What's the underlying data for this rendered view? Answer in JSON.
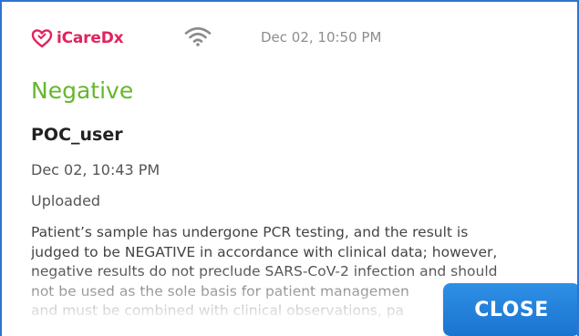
{
  "app": {
    "logo_text": "iCareDx",
    "logo_icon": "heart-icon",
    "brand_color": "#e0245e"
  },
  "status_bar": {
    "wifi_icon": "wifi-icon",
    "time": "Dec 02, 10:50 PM"
  },
  "result": {
    "title": "Negative",
    "title_color": "#64b82c",
    "user": "POC_user",
    "test_time": "Dec 02, 10:43 PM",
    "upload_status": "Uploaded",
    "disclaimer_lines": [
      "Patient’s sample has undergone PCR testing, and the result is",
      "judged to be NEGATIVE in accordance with clinical data; however,",
      "negative results do not preclude SARS-CoV-2 infection and should",
      "not be used as the sole basis for patient managemen",
      "and must be combined with clinical observations, pa"
    ]
  },
  "actions": {
    "close_label": "CLOSE",
    "button_color": "#1f7fd9"
  }
}
